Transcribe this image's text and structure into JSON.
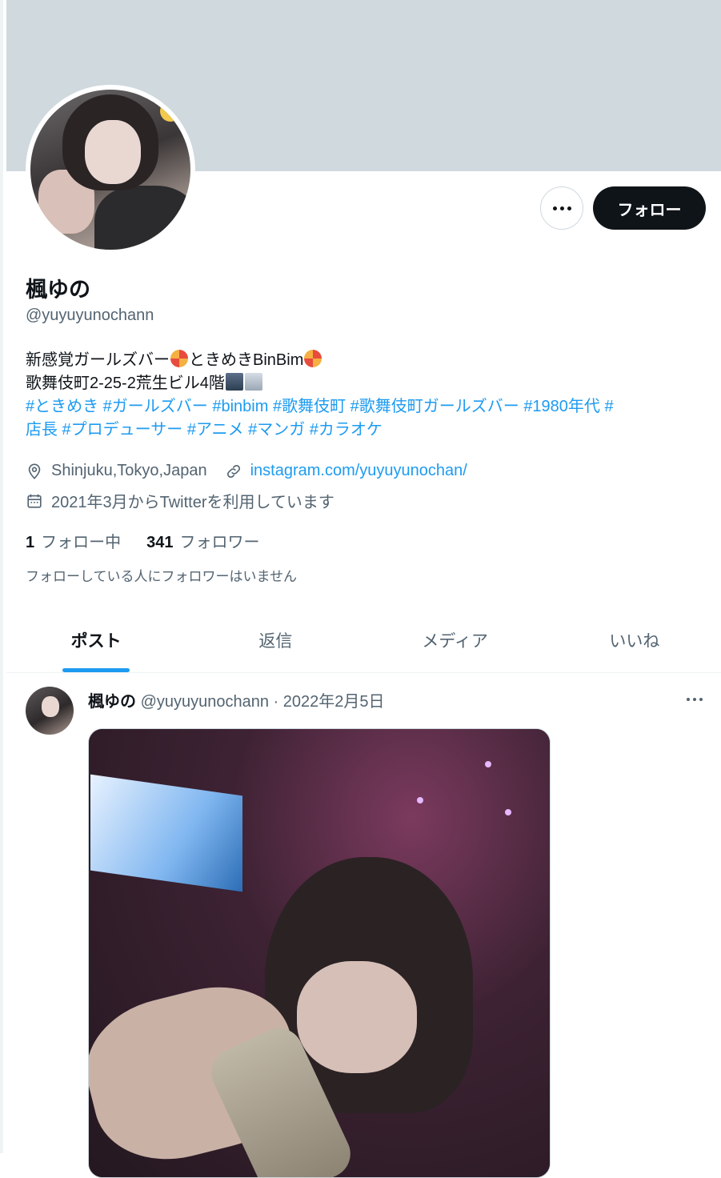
{
  "profile": {
    "name": "楓ゆの",
    "handle": "@yuyuyunochann",
    "bio_line1_a": "新感覚ガールズバー",
    "bio_line1_b": "ときめきBinBim",
    "bio_line2": "歌舞伎町2-25-2荒生ビル4階",
    "bio_tags_line1": "#ときめき #ガールズバー #binbim #歌舞伎町 #歌舞伎町ガールズバー #1980年代 #",
    "bio_tags_line2": "店長 #プロデューサー #アニメ #マンガ #カラオケ",
    "location": "Shinjuku,Tokyo,Japan",
    "website": "instagram.com/yuyuyunochan/",
    "joined": "2021年3月からTwitterを利用しています",
    "following_count": "1",
    "following_label": "フォロー中",
    "followers_count": "341",
    "followers_label": "フォロワー",
    "mutual_note": "フォローしている人にフォロワーはいません"
  },
  "actions": {
    "follow_label": "フォロー"
  },
  "tabs": [
    {
      "label": "ポスト",
      "active": true
    },
    {
      "label": "返信",
      "active": false
    },
    {
      "label": "メディア",
      "active": false
    },
    {
      "label": "いいね",
      "active": false
    }
  ],
  "tweet": {
    "author_name": "楓ゆの",
    "author_handle": "@yuyuyunochann",
    "separator": "·",
    "date": "2022年2月5日"
  },
  "icons": {
    "location": "location-pin-icon",
    "link": "link-icon",
    "calendar": "calendar-icon",
    "more": "more-dots-icon"
  },
  "colors": {
    "accent": "#1d9bf0",
    "banner": "#cfd9de",
    "follow_button": "#0f1419",
    "secondary_text": "#536471"
  }
}
